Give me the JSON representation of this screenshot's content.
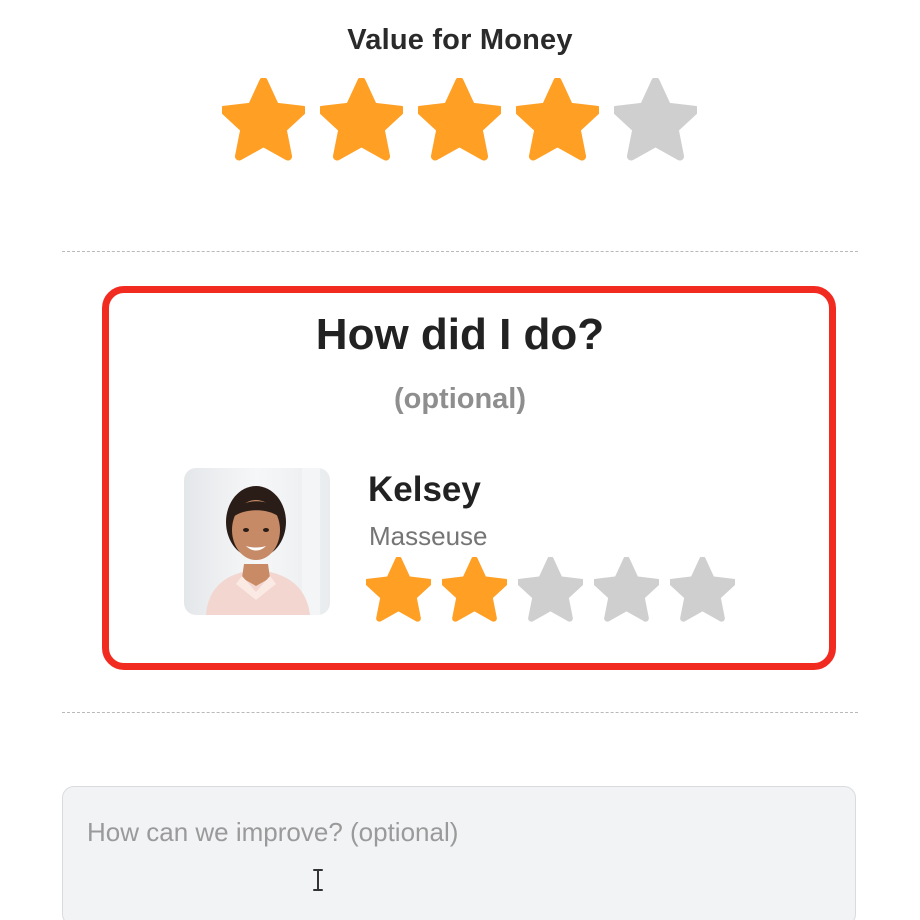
{
  "value_for_money": {
    "title": "Value for Money",
    "rating": 4,
    "max_rating": 5
  },
  "staff_section": {
    "title": "How did I do?",
    "subtitle": "(optional)",
    "staff": {
      "name": "Kelsey",
      "role": "Masseuse",
      "rating": 2,
      "max_rating": 5,
      "avatar_icon": "person-photo"
    }
  },
  "feedback": {
    "placeholder": "How can we improve? (optional)",
    "value": ""
  },
  "colors": {
    "star_filled": "#ff9f24",
    "star_empty": "#cfcfcf",
    "highlight_border": "#f22b21"
  }
}
